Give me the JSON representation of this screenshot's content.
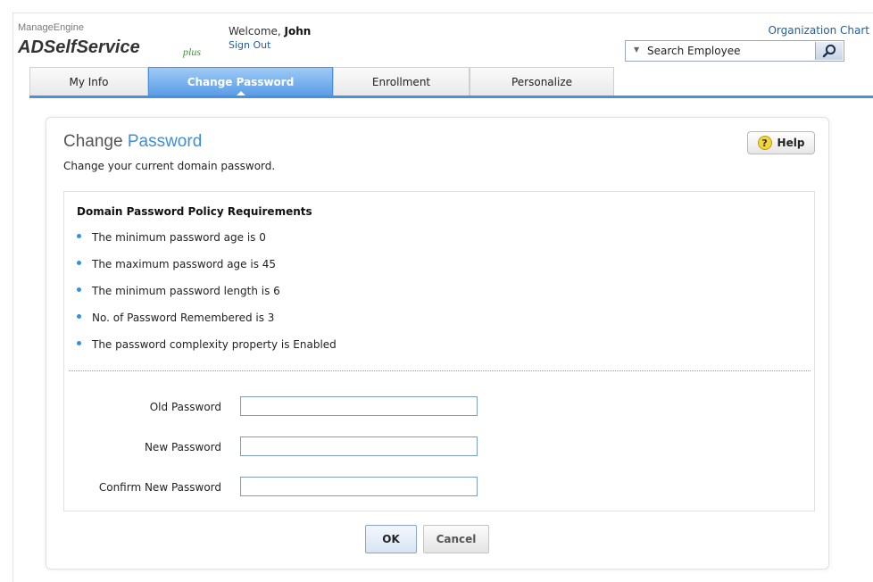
{
  "brand": {
    "company": "ManageEngine",
    "product": "ADSelfService",
    "suffix": "plus"
  },
  "header": {
    "welcome_text": "Welcome,",
    "user_name": "John",
    "sign_out": "Sign Out",
    "org_chart_link": "Organization Chart",
    "search": {
      "placeholder": "Search Employee",
      "caret_icon": "chevron-down-icon",
      "button_icon": "search-icon"
    }
  },
  "tabs": [
    {
      "label": "My Info",
      "active": false
    },
    {
      "label": "Change Password",
      "active": true
    },
    {
      "label": "Enrollment",
      "active": false
    },
    {
      "label": "Personalize",
      "active": false
    }
  ],
  "page": {
    "title_part1": "Change",
    "title_part2": "Password",
    "subtitle": "Change your current domain password.",
    "help_label": "Help",
    "help_icon_glyph": "?"
  },
  "policy": {
    "heading": "Domain Password Policy Requirements",
    "items": [
      "The minimum password age is 0",
      "The maximum password age is 45",
      "The minimum password length is 6",
      "No. of Password Remembered is 3",
      "The password complexity property is Enabled"
    ]
  },
  "form": {
    "fields": [
      {
        "label": "Old Password",
        "value": ""
      },
      {
        "label": "New Password",
        "value": ""
      },
      {
        "label": "Confirm New Password",
        "value": ""
      }
    ],
    "ok_label": "OK",
    "cancel_label": "Cancel"
  },
  "colors": {
    "accent": "#3c8ed8",
    "active_tab": "#5a9de6",
    "link": "#1f5fa8",
    "brand_plus": "#3a9a3a"
  }
}
